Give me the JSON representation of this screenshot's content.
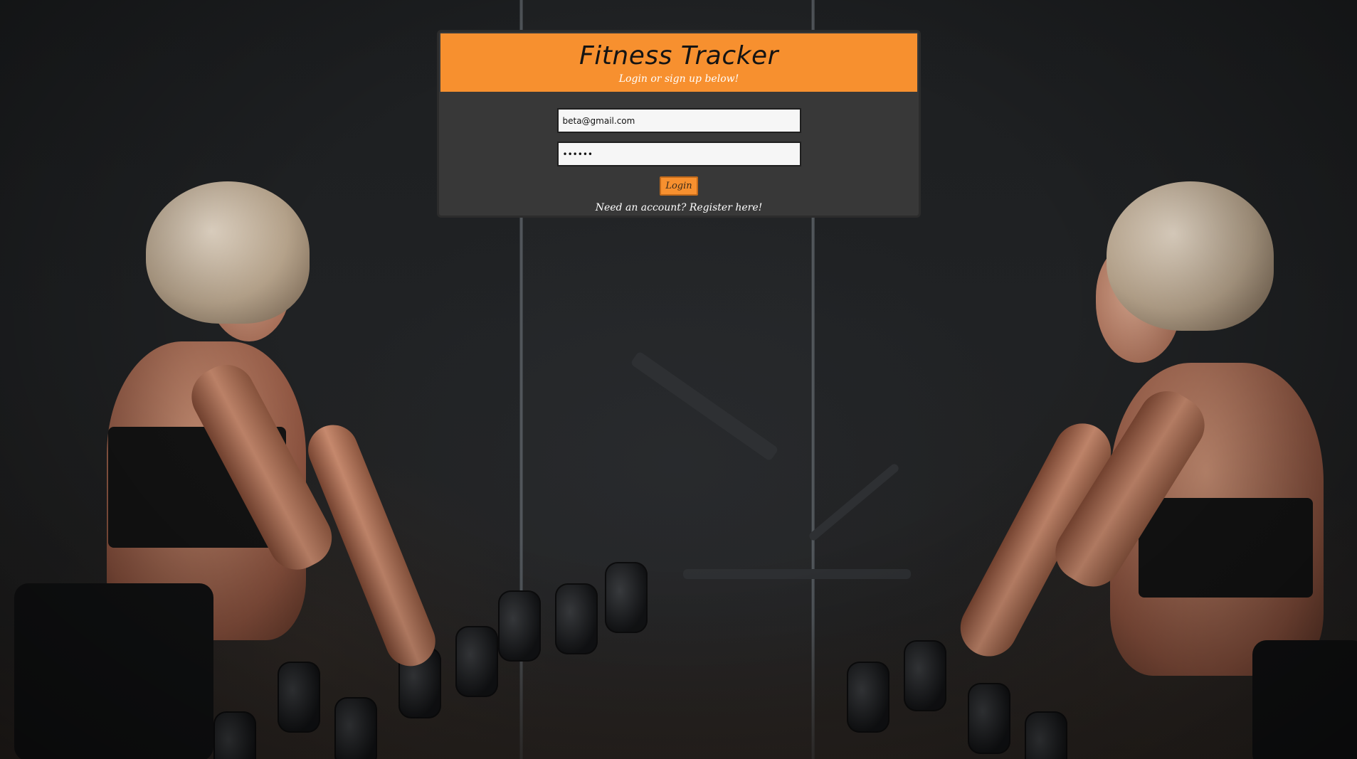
{
  "app": {
    "title": "Fitness Tracker",
    "subtitle": "Login or sign up below!"
  },
  "form": {
    "email_value": "beta@gmail.com",
    "password_value": "passwd",
    "login_label": "Login",
    "register_text": "Need an account? Register here!"
  },
  "colors": {
    "accent": "#f7902f",
    "card_background": "#383838",
    "page_background": "#141618"
  }
}
